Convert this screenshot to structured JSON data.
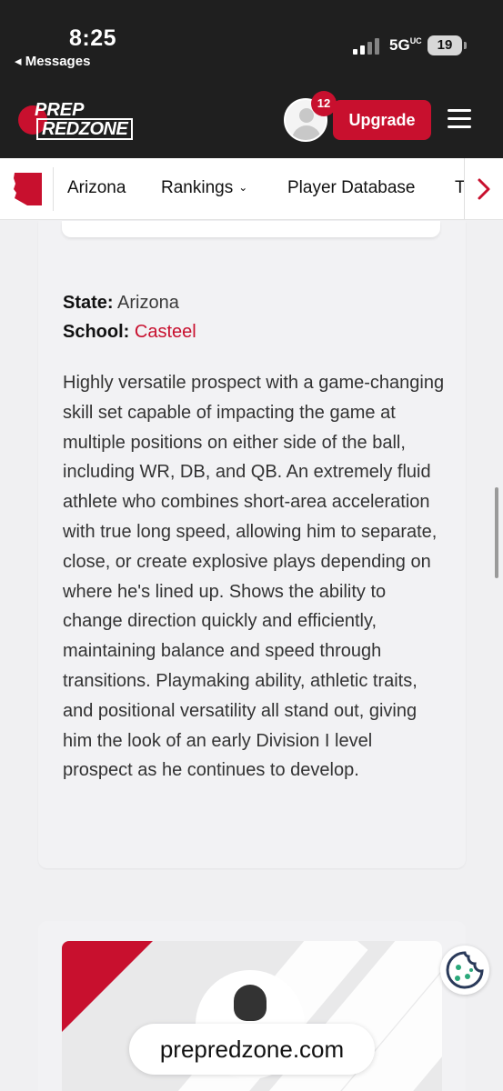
{
  "status_bar": {
    "time": "8:25",
    "back_label": "◂ Messages",
    "network": "5G",
    "network_sup": "UC",
    "battery": "19"
  },
  "header": {
    "logo_top": "PREP",
    "logo_bottom": "REDZONE",
    "notification_count": "12",
    "upgrade_label": "Upgrade",
    "accent_color": "#c8102e"
  },
  "nav": {
    "items": [
      {
        "label": "Arizona"
      },
      {
        "label": "Rankings"
      },
      {
        "label": "Player Database"
      },
      {
        "label": "T"
      }
    ]
  },
  "profile": {
    "state_label": "State:",
    "state_value": "Arizona",
    "school_label": "School:",
    "school_value": "Casteel",
    "description": "Highly versatile prospect with a game-changing skill set capable of impacting the game at multiple positions on either side of the ball, including WR, DB, and QB. An extremely fluid athlete who combines short-area acceleration with true long speed, allowing him to separate, close, or create explosive plays depending on where he's lined up. Shows the ability to change direction quickly and efficiently, maintaining balance and speed through transitions. Playmaking ability, athletic traits, and positional versatility all stand out, giving him the look of an early Division I level prospect as he continues to develop."
  },
  "watermark": {
    "domain": "prepredzone.com"
  }
}
